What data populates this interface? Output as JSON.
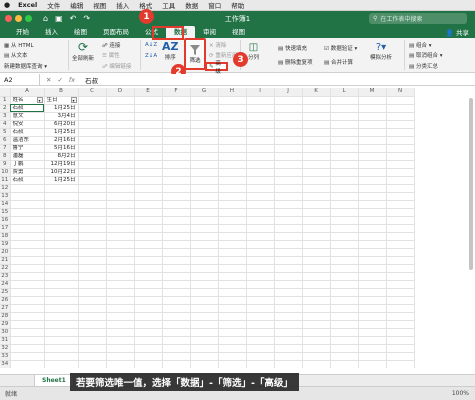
{
  "menubar": {
    "apple": "",
    "app": "Excel",
    "items": [
      "文件",
      "编辑",
      "视图",
      "插入",
      "格式",
      "工具",
      "数据",
      "窗口",
      "帮助"
    ]
  },
  "titlebar": {
    "title": "工作簿1",
    "search_placeholder": "在工作表中搜索"
  },
  "tabs": [
    "开始",
    "插入",
    "绘图",
    "页面布局",
    "公式",
    "数据",
    "审阅",
    "视图"
  ],
  "share_label": "共享",
  "ribbon": {
    "from_html": "从 HTML",
    "from_text": "从文本",
    "new_query": "新建数据库查询",
    "refresh_all": "全部刷新",
    "connections": "连接",
    "properties": "属性",
    "edit_links": "编辑链接",
    "sort": "排序",
    "filter": "筛选",
    "clear": "清除",
    "reapply": "重新应用",
    "advanced": "高级",
    "split": "分列",
    "flash_fill": "快速填充",
    "remove_duplicates": "删除重复项",
    "data_validation": "数据验证",
    "consolidate": "合并计算",
    "what_if": "模拟分析",
    "group": "组合",
    "ungroup": "取消组合",
    "subtotal": "分类汇总"
  },
  "tooltip": "高级",
  "formula_bar": {
    "cell_ref": "A2",
    "value": "石叔"
  },
  "columns": [
    "A",
    "B",
    "C",
    "D",
    "E",
    "F",
    "G",
    "H",
    "I",
    "J",
    "K",
    "L",
    "M",
    "N"
  ],
  "sheet": {
    "header": [
      "姓名",
      "生日"
    ],
    "rows": [
      [
        "石叔",
        "1月25日"
      ],
      [
        "意文",
        "3月4日"
      ],
      [
        "倪安",
        "6月20日"
      ],
      [
        "石叔",
        "1月25日"
      ],
      [
        "温洁东",
        "2月16日"
      ],
      [
        "鲁宁",
        "5月16日"
      ],
      [
        "潘磊",
        "8月2日"
      ],
      [
        "丁鹏",
        "12月19日"
      ],
      [
        "贾勇",
        "10月22日"
      ],
      [
        "石叔",
        "1月25日"
      ]
    ]
  },
  "sheet_tab": "Sheet1",
  "status": "就绪",
  "zoom": "100%",
  "badges": [
    "1",
    "2",
    "3"
  ],
  "caption": "若要筛选唯一值，选择「数据」-「筛选」-「高级」"
}
